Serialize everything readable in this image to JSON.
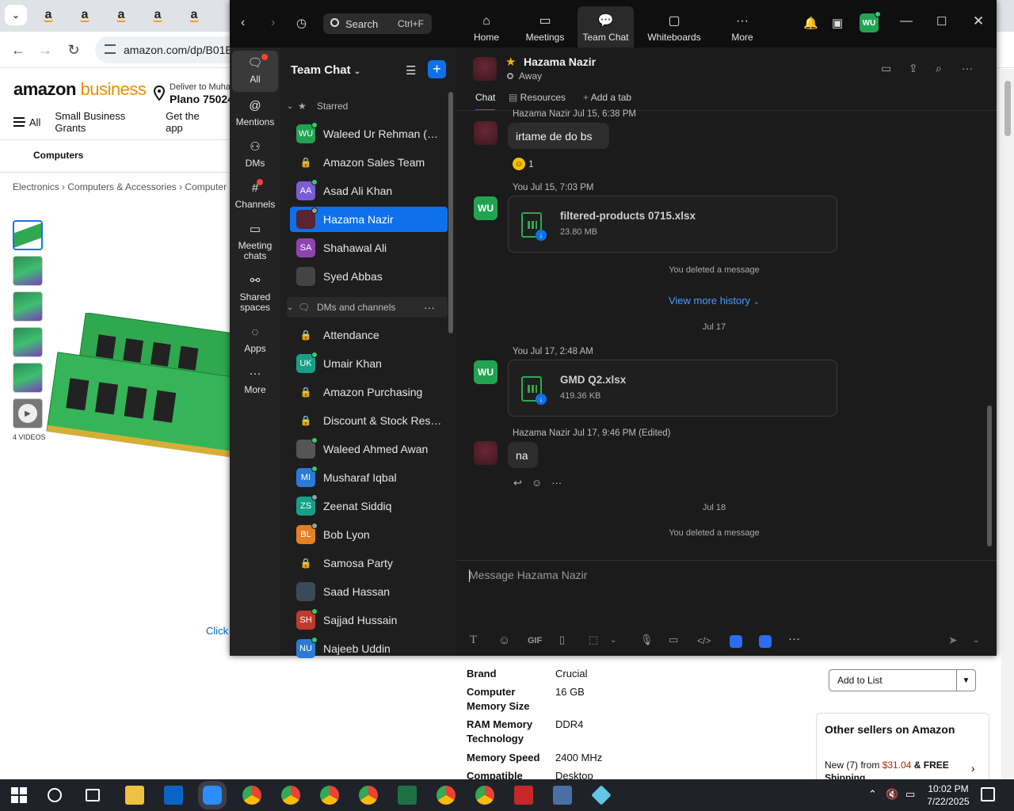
{
  "browser": {
    "tab_glyph": "a",
    "url": "amazon.com/dp/B01E",
    "amazon": {
      "logo_main": "amazon",
      "logo_biz": "business",
      "deliver_line1": "Deliver to Muhar",
      "deliver_line2": "Plano 75024",
      "nav": [
        "All",
        "Small Business Grants",
        "Get the app"
      ],
      "sub_nav": "Computers",
      "breadcrumb": "Electronics › Computers & Accessories › Computer Com",
      "videos_label": "4 VIDEOS",
      "click_text": "Click t",
      "details": [
        {
          "k": "Brand",
          "v": "Crucial"
        },
        {
          "k": "Computer Memory Size",
          "v": "16 GB"
        },
        {
          "k": "RAM Memory Technology",
          "v": "DDR4"
        },
        {
          "k": "Memory Speed",
          "v": "2400 MHz"
        },
        {
          "k": "Compatible",
          "v": "Desktop"
        }
      ],
      "add_to_list": "Add to List",
      "other_sellers_title": "Other sellers on Amazon",
      "other_sellers_new": "New (7) from",
      "other_sellers_price": "$31.04",
      "other_sellers_ship": "& FREE Shipping"
    }
  },
  "zoom": {
    "search_placeholder": "Search",
    "search_shortcut": "Ctrl+F",
    "top_nav": [
      {
        "label": "Home",
        "icon": "home-icon"
      },
      {
        "label": "Meetings",
        "icon": "video-icon"
      },
      {
        "label": "Team Chat",
        "icon": "chat-icon"
      },
      {
        "label": "Whiteboards",
        "icon": "whiteboard-icon"
      },
      {
        "label": "More",
        "icon": "ellipsis-icon"
      }
    ],
    "user_initials": "WU",
    "rail": [
      {
        "label": "All",
        "icon": "chat-bubble-icon"
      },
      {
        "label": "Mentions",
        "icon": "at-icon"
      },
      {
        "label": "DMs",
        "icon": "people-icon"
      },
      {
        "label": "Channels",
        "icon": "hash-icon"
      },
      {
        "label": "Meeting chats",
        "icon": "calendar-icon"
      },
      {
        "label": "Shared spaces",
        "icon": "share-icon"
      },
      {
        "label": "Apps",
        "icon": "apps-icon"
      },
      {
        "label": "More",
        "icon": "ellipsis-icon"
      }
    ],
    "list_title": "Team Chat",
    "starred_label": "Starred",
    "starred": [
      {
        "initials": "WU",
        "name": "Waleed Ur Rehman (you)",
        "color": "#22a352",
        "status": "on"
      },
      {
        "initials": "",
        "name": "Amazon Sales Team",
        "color": "",
        "status": "lock"
      },
      {
        "initials": "AA",
        "name": "Asad Ali Khan",
        "color": "#7b5cd6",
        "status": "on"
      },
      {
        "initials": "",
        "name": "Hazama Nazir",
        "color": "#5a2530",
        "status": "away"
      },
      {
        "initials": "SA",
        "name": "Shahawal Ali",
        "color": "#8e44ad",
        "status": "none"
      },
      {
        "initials": "",
        "name": "Syed Abbas",
        "color": "#444444",
        "status": "none"
      }
    ],
    "dms_label": "DMs and channels",
    "dms": [
      {
        "initials": "",
        "name": "Attendance",
        "color": "",
        "status": "lock"
      },
      {
        "initials": "UK",
        "name": "Umair Khan",
        "color": "#16a085",
        "status": "on"
      },
      {
        "initials": "",
        "name": "Amazon Purchasing",
        "color": "",
        "status": "lock"
      },
      {
        "initials": "",
        "name": "Discount & Stock Reser...",
        "color": "",
        "status": "lock"
      },
      {
        "initials": "",
        "name": "Waleed Ahmed Awan",
        "color": "#555555",
        "status": "on"
      },
      {
        "initials": "MI",
        "name": "Musharaf Iqbal",
        "color": "#2b7bd6",
        "status": "on"
      },
      {
        "initials": "ZS",
        "name": "Zeenat Siddiq",
        "color": "#16a085",
        "status": "away"
      },
      {
        "initials": "BL",
        "name": "Bob Lyon",
        "color": "#e67e22",
        "status": "away"
      },
      {
        "initials": "",
        "name": "Samosa Party",
        "color": "",
        "status": "lock"
      },
      {
        "initials": "",
        "name": "Saad Hassan",
        "color": "#3a4a5a",
        "status": "none"
      },
      {
        "initials": "SH",
        "name": "Sajjad Hussain",
        "color": "#c0392b",
        "status": "on"
      },
      {
        "initials": "NU",
        "name": "Najeeb Uddin",
        "color": "#2b7bd6",
        "status": "on"
      }
    ],
    "chat": {
      "name": "Hazama Nazir",
      "status": "Away",
      "tabs": [
        "Chat",
        "Resources",
        "Add a tab"
      ],
      "messages": {
        "m1_meta": "Hazama Nazir Jul 15, 6:38 PM",
        "m1_text": "irtame de do bs",
        "m1_reaction_count": "1",
        "m2_meta": "You Jul 15, 7:03 PM",
        "m2_file": "filtered-products 0715.xlsx",
        "m2_size": "23.80 MB",
        "deleted1": "You deleted a message",
        "view_more": "View more history",
        "date1": "Jul 17",
        "m3_meta": "You Jul 17, 2:48 AM",
        "m3_file": "GMD Q2.xlsx",
        "m3_size": "419.36 KB",
        "m4_meta": "Hazama Nazir Jul 17, 9:46 PM (Edited)",
        "m4_text": "na",
        "date2": "Jul 18",
        "deleted2": "You deleted a message"
      },
      "composer_placeholder": "Message Hazama Nazir",
      "composer_gif": "GIF"
    }
  },
  "taskbar": {
    "time": "10:02 PM",
    "date": "7/22/2025"
  }
}
